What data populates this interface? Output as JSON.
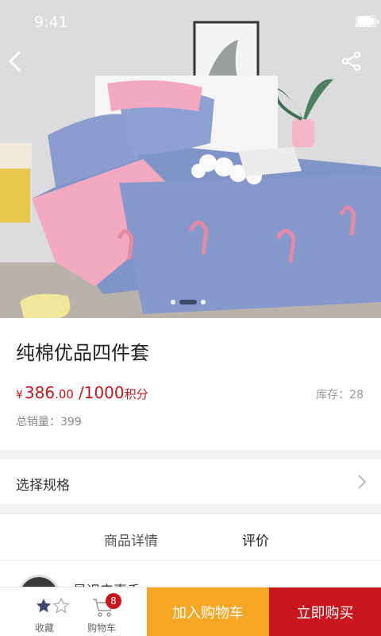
{
  "status_bar": {
    "time": "9:41"
  },
  "gallery": {
    "slide_count": 3,
    "active_index": 1
  },
  "product": {
    "title": "纯棉优品四件套",
    "price_currency": "¥",
    "price_int": "386",
    "price_dec": ".00",
    "price_slash": "/",
    "points_value": "1000",
    "points_unit": "积分",
    "stock_label": "库存：",
    "stock_value": "28",
    "sales_label": "总销量：",
    "sales_value": "399"
  },
  "spec": {
    "label": "选择规格"
  },
  "tabs": [
    {
      "label": "商品详情",
      "active": false
    },
    {
      "label": "评价",
      "active": true
    }
  ],
  "review": {
    "username": "是迟来惠香"
  },
  "bottom_bar": {
    "favorite_label": "收藏",
    "cart_label": "购物车",
    "cart_count": "8",
    "add_to_cart": "加入购物车",
    "buy_now": "立即购买"
  },
  "colors": {
    "accent_red": "#c9151e",
    "accent_orange": "#f5a623",
    "star_active": "#3d4a6e"
  },
  "icons": [
    "back-arrow-icon",
    "share-icon",
    "signal-icon",
    "wifi-icon",
    "battery-icon",
    "star-icon",
    "cart-icon",
    "chevron-right-icon"
  ]
}
